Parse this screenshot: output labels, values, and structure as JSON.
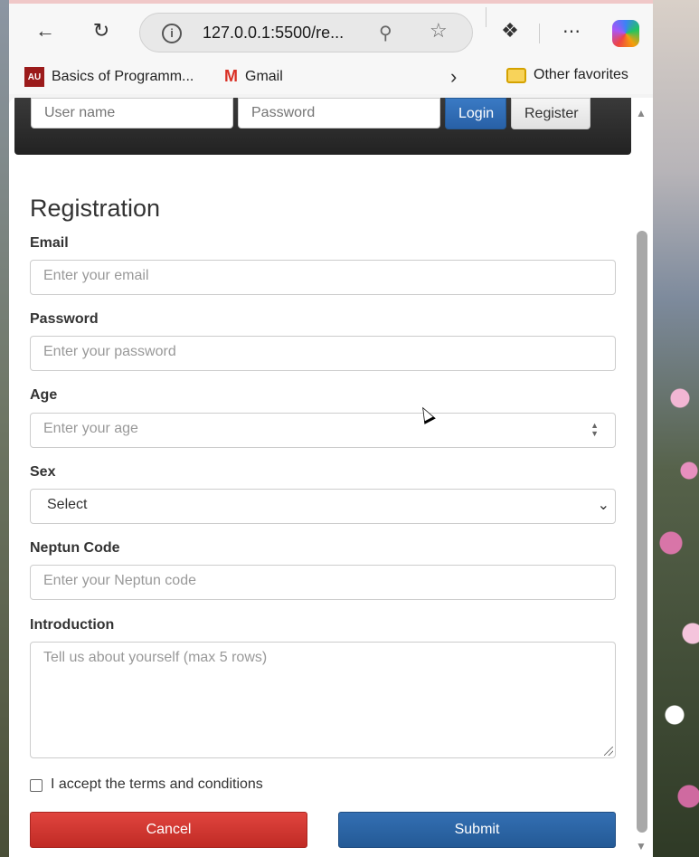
{
  "browser": {
    "url": "127.0.0.1:5500/re...",
    "icons": [
      "back-arrow-icon",
      "refresh-icon",
      "info-icon",
      "zoom-out-icon",
      "favorite-star-icon",
      "extensions-icon",
      "more-icon",
      "copilot-icon"
    ]
  },
  "bookmarks": {
    "items": [
      {
        "label": "Basics of Programm...",
        "icon": "au-logo-icon"
      },
      {
        "label": "Gmail",
        "icon": "gmail-icon"
      }
    ],
    "other": "Other favorites"
  },
  "navbar": {
    "username_placeholder": "User name",
    "password_placeholder": "Password",
    "login_label": "Login",
    "register_label": "Register"
  },
  "form": {
    "title": "Registration",
    "email": {
      "label": "Email",
      "placeholder": "Enter your email"
    },
    "password": {
      "label": "Password",
      "placeholder": "Enter your password"
    },
    "age": {
      "label": "Age",
      "placeholder": "Enter your age"
    },
    "sex": {
      "label": "Sex",
      "selected": "Select"
    },
    "neptun": {
      "label": "Neptun Code",
      "placeholder": "Enter your Neptun code"
    },
    "introduction": {
      "label": "Introduction",
      "placeholder": "Tell us about yourself (max 5 rows)"
    },
    "terms_label": "I accept the terms and conditions",
    "terms_checked": false,
    "cancel_label": "Cancel",
    "submit_label": "Submit"
  },
  "colors": {
    "cancel": "#d0352f",
    "submit": "#2d64a5",
    "login": "#2f6cb5",
    "navbar": "#2b2b2b"
  }
}
